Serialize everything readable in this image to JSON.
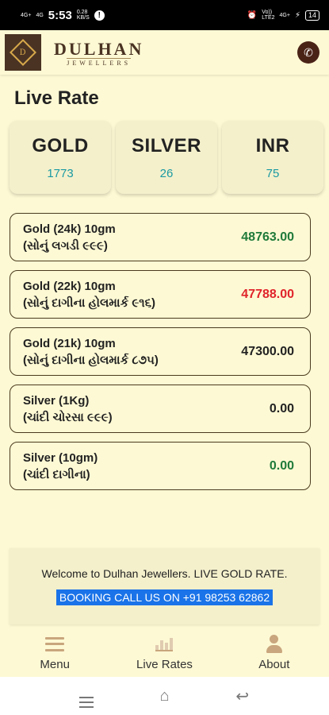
{
  "status_bar": {
    "time": "5:53",
    "net_speed": "0.28\nKB/S",
    "net_left": "4G+",
    "net_right": "4G",
    "vo_lte": "Vo))\nLTE2",
    "net_4g": "4G+",
    "battery": "14"
  },
  "header": {
    "brand": "DULHAN",
    "brand_sub": "JEWELLERS"
  },
  "page_title": "Live Rate",
  "cards": [
    {
      "name": "GOLD",
      "value": "1773"
    },
    {
      "name": "SILVER",
      "value": "26"
    },
    {
      "name": "INR",
      "value": "75"
    }
  ],
  "rates": [
    {
      "label": "Gold (24k) 10gm",
      "sub": "(સોનું લગડી ૯૯૯)",
      "value": "48763.00",
      "color": "#1f7a3a"
    },
    {
      "label": "Gold (22k) 10gm",
      "sub": "(સોનું દાગીના હોલમાર્ક ૯૧૬)",
      "value": "47788.00",
      "color": "#e0242b"
    },
    {
      "label": "Gold (21k) 10gm",
      "sub": "(સોનું દાગીના હોલમાર્ક ૮૭૫)",
      "value": "47300.00",
      "color": "#222222"
    },
    {
      "label": "Silver (1Kg)",
      "sub": "(ચાંદી ચોરસા ૯૯૯)",
      "value": "0.00",
      "color": "#222222"
    },
    {
      "label": "Silver (10gm)",
      "sub": "(ચાંદી દાગીના)",
      "value": "0.00",
      "color": "#1f7a3a"
    }
  ],
  "marquee": {
    "welcome": "Welcome to Dulhan Jewellers. LIVE GOLD RATE.",
    "booking": "BOOKING CALL US ON  +91 98253 62862"
  },
  "bottom_nav": {
    "menu": "Menu",
    "live_rates": "Live Rates",
    "about": "About"
  },
  "colors": {
    "background": "#fdf9d4",
    "accent_teal": "#1a9aa2",
    "booking_bg": "#1a73e8",
    "brand_brown": "#4a3323"
  }
}
